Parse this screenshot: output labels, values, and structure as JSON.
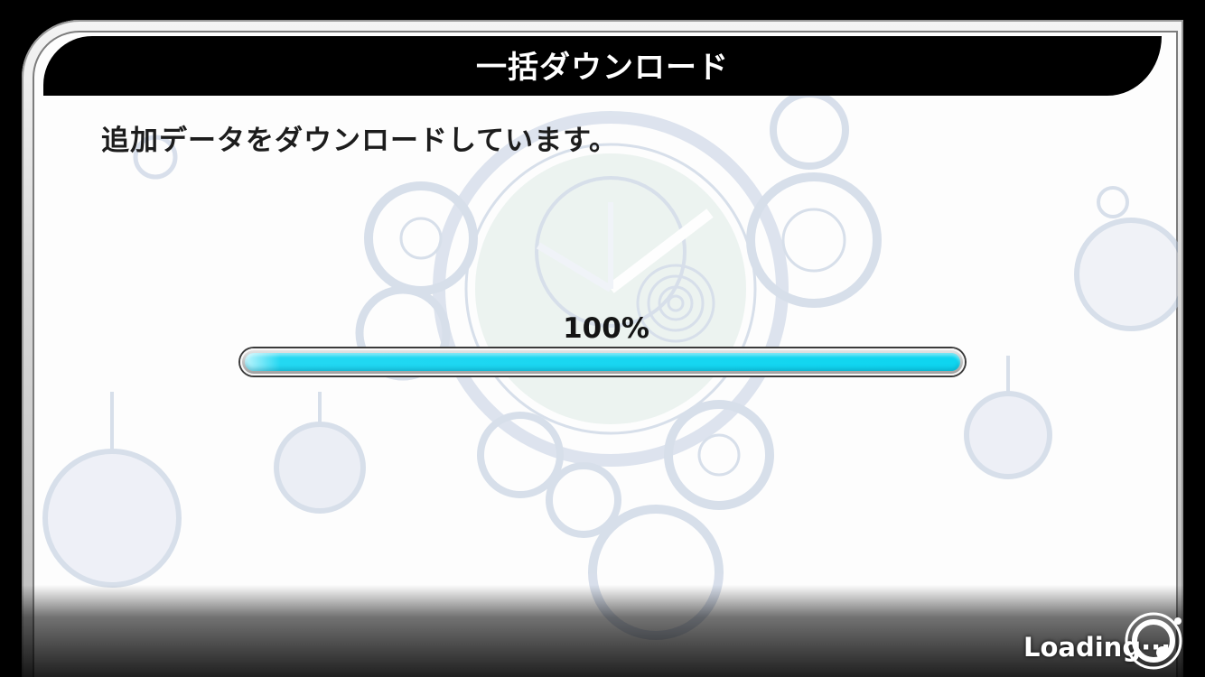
{
  "dialog": {
    "title": "一括ダウンロード",
    "message": "追加データをダウンロードしています。"
  },
  "progress": {
    "label": "100%",
    "fraction": 1.0
  },
  "loading": {
    "text": "Loading···",
    "icon": "loading-spinner-icon"
  },
  "colors": {
    "title_bar": "#000000",
    "progress_fill": "#0ed5f0",
    "background": "#000000"
  }
}
